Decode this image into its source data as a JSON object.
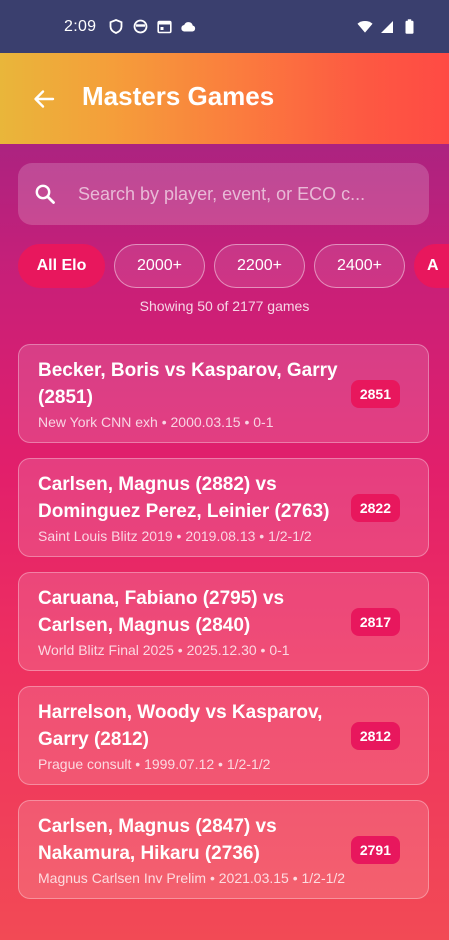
{
  "status_bar": {
    "time": "2:09",
    "left_icons": [
      "shield-icon",
      "circle-face-icon",
      "calendar-icon",
      "cloud-icon"
    ],
    "right_icons": [
      "wifi-icon",
      "signal-icon",
      "battery-icon"
    ]
  },
  "app_bar": {
    "title": "Masters Games",
    "back_icon": "arrow-left-icon"
  },
  "search": {
    "placeholder": "Search by player, event, or ECO c...",
    "value": ""
  },
  "filters": [
    {
      "label": "All Elo",
      "active": true
    },
    {
      "label": "2000+",
      "active": false
    },
    {
      "label": "2200+",
      "active": false
    },
    {
      "label": "2400+",
      "active": false
    },
    {
      "label": "A",
      "active": true
    }
  ],
  "summary": "Showing 50 of 2177 games",
  "games": [
    {
      "title": "Becker, Boris vs Kasparov, Garry (2851)",
      "meta": "New York CNN exh • 2000.03.15 • 0-1",
      "elo": "2851"
    },
    {
      "title": "Carlsen, Magnus (2882) vs Dominguez Perez, Leinier (2763)",
      "meta": "Saint Louis Blitz 2019 • 2019.08.13 • 1/2-1/2",
      "elo": "2822"
    },
    {
      "title": "Caruana, Fabiano (2795) vs Carlsen, Magnus (2840)",
      "meta": "World Blitz Final 2025 • 2025.12.30 • 0-1",
      "elo": "2817"
    },
    {
      "title": "Harrelson, Woody vs Kasparov, Garry (2812)",
      "meta": "Prague consult • 1999.07.12 • 1/2-1/2",
      "elo": "2812"
    },
    {
      "title": "Carlsen, Magnus (2847) vs Nakamura, Hikaru (2736)",
      "meta": "Magnus Carlsen Inv Prelim • 2021.03.15 • 1/2-1/2",
      "elo": "2791"
    }
  ]
}
